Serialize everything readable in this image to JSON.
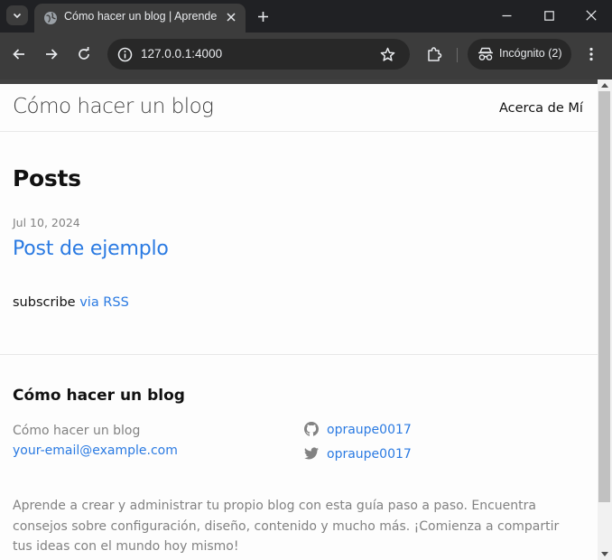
{
  "browser": {
    "tab_title": "Cómo hacer un blog | Aprende a crear tu blog",
    "url": "127.0.0.1:4000",
    "incognito_label": "Incógnito (2)"
  },
  "site": {
    "title": "Cómo hacer un blog",
    "nav": [
      "Acerca de Mí"
    ]
  },
  "main": {
    "heading": "Posts",
    "posts": [
      {
        "date": "Jul 10, 2024",
        "title": "Post de ejemplo"
      }
    ],
    "subscribe_text": "subscribe ",
    "subscribe_link": "via RSS"
  },
  "footer": {
    "heading": "Cómo hacer un blog",
    "name": "Cómo hacer un blog",
    "email": "your-email@example.com",
    "social": [
      {
        "icon": "github-icon",
        "label": "opraupe0017"
      },
      {
        "icon": "twitter-icon",
        "label": "opraupe0017"
      }
    ],
    "description": "Aprende a crear y administrar tu propio blog con esta guía paso a paso. Encuentra consejos sobre configuración, diseño, contenido y mucho más. ¡Comienza a compartir tus ideas con el mundo hoy mismo!"
  },
  "colors": {
    "link": "#2a7ae2",
    "muted": "#828282",
    "text": "#111111",
    "header_border": "#424242",
    "chrome_bg": "#3c3c3c",
    "tabstrip_bg": "#202124"
  }
}
